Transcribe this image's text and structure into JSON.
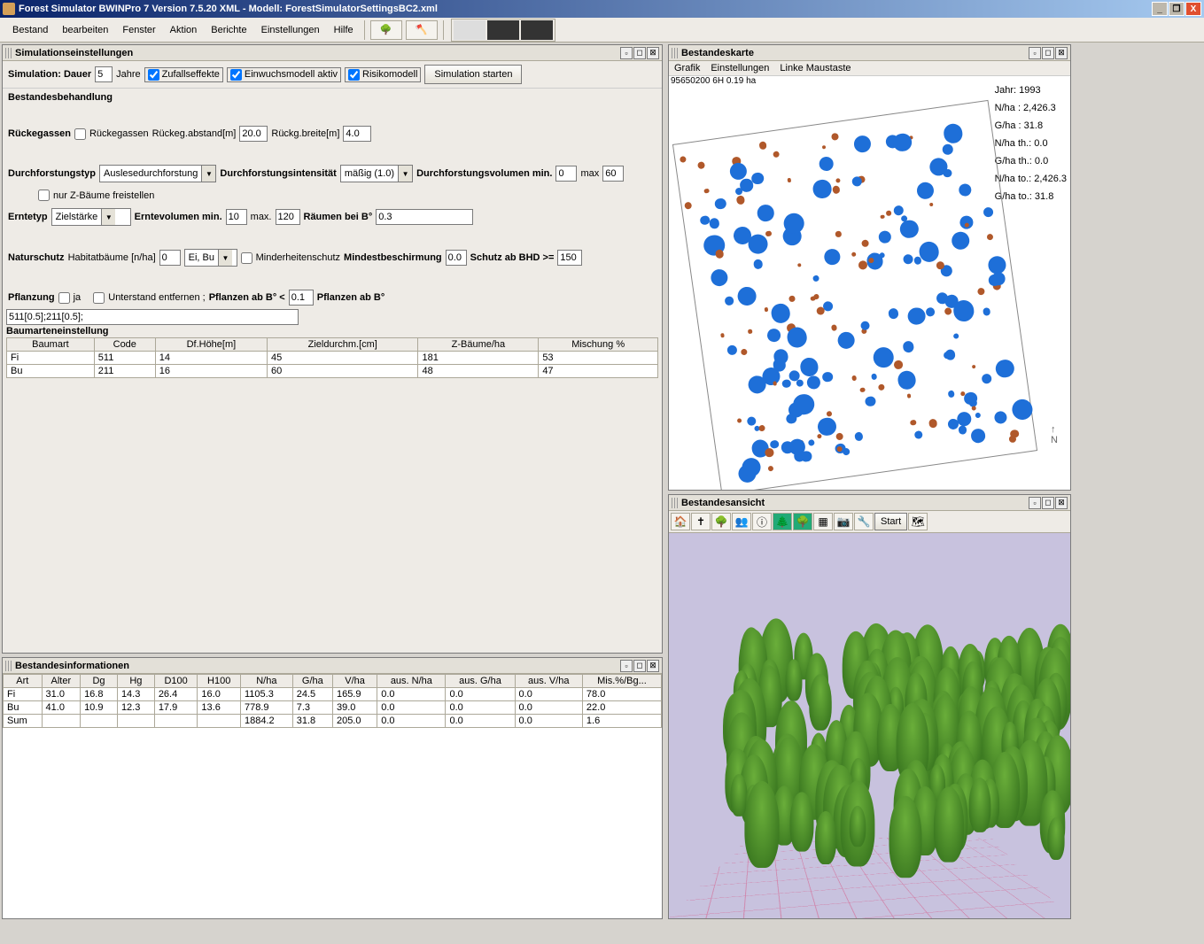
{
  "window": {
    "title": "Forest Simulator BWINPro 7 Version 7.5.20 XML - Modell: ForestSimulatorSettingsBC2.xml"
  },
  "menu": {
    "items": [
      "Bestand",
      "bearbeiten",
      "Fenster",
      "Aktion",
      "Berichte",
      "Einstellungen",
      "Hilfe"
    ]
  },
  "panels": {
    "sim": {
      "title": "Simulationseinstellungen"
    },
    "info": {
      "title": "Bestandesinformationen"
    },
    "map": {
      "title": "Bestandeskarte"
    },
    "view": {
      "title": "Bestandesansicht"
    }
  },
  "sim": {
    "simLabel": "Simulation: Dauer",
    "duration": "5",
    "years": "Jahre",
    "zufall": "Zufallseffekte",
    "einwuchs": "Einwuchsmodell aktiv",
    "risiko": "Risikomodell",
    "startBtn": "Simulation starten",
    "bestand": "Bestandesbehandlung",
    "ruecke": "Rückegassen",
    "rueckeChk": "Rückegassen",
    "rueckeAbst": "Rückeg.abstand[m]",
    "rueckeAbstV": "20.0",
    "rueckeBreite": "Rückg.breite[m]",
    "rueckeBreiteV": "4.0",
    "dfTyp": "Durchforstungstyp",
    "dfTypV": "Auslesedurchforstung",
    "dfInt": "Durchforstungsintensität",
    "dfIntV": "mäßig (1.0)",
    "dfVol": "Durchforstungsvolumen min.",
    "dfVolMin": "0",
    "max": "max",
    "dfVolMax": "60",
    "nurZ": "nur Z-Bäume freistellen",
    "ernte": "Erntetyp",
    "ernteV": "Zielstärke",
    "ernteVolMin": "Erntevolumen min.",
    "ernteVolMinV": "10",
    "ernteMax": "max.",
    "ernteVolMaxV": "120",
    "raeumen": "Räumen bei B°",
    "raeumenV": "0.3",
    "natur": "Naturschutz",
    "habitat": "Habitatbäume [n/ha]",
    "habitatV": "0",
    "species": "Ei, Bu",
    "minder": "Minderheitenschutz",
    "mindest": "Mindestbeschirmung",
    "mindestV": "0.0",
    "schutz": "Schutz ab BHD >=",
    "schutzV": "150",
    "pflanz": "Pflanzung",
    "ja": "ja",
    "unterstand": "Unterstand entfernen ;",
    "pflanzAb": "Pflanzen ab B°  <",
    "pflanzAbV": "0.1",
    "pflanzAb2": "Pflanzen ab B°",
    "pflanzStr": "511[0.5];211[0.5];",
    "baumEinst": "Baumarteneinstellung",
    "tblHead": [
      "Baumart",
      "Code",
      "Df.Höhe[m]",
      "Zieldurchm.[cm]",
      "Z-Bäume/ha",
      "Mischung %"
    ],
    "tblRows": [
      [
        "Fi",
        "511",
        "14",
        "45",
        "181",
        "53"
      ],
      [
        "Bu",
        "211",
        "16",
        "60",
        "48",
        "47"
      ]
    ]
  },
  "info": {
    "head": [
      "Art",
      "Alter",
      "Dg",
      "Hg",
      "D100",
      "H100",
      "N/ha",
      "G/ha",
      "V/ha",
      "aus. N/ha",
      "aus. G/ha",
      "aus. V/ha",
      "Mis.%/Bg..."
    ],
    "rows": [
      [
        "Fi",
        "31.0",
        "16.8",
        "14.3",
        "26.4",
        "16.0",
        "1105.3",
        "24.5",
        "165.9",
        "0.0",
        "0.0",
        "0.0",
        "78.0"
      ],
      [
        "Bu",
        "41.0",
        "10.9",
        "12.3",
        "17.9",
        "13.6",
        "778.9",
        "7.3",
        "39.0",
        "0.0",
        "0.0",
        "0.0",
        "22.0"
      ],
      [
        "Sum",
        "",
        "",
        "",
        "",
        "",
        "1884.2",
        "31.8",
        "205.0",
        "0.0",
        "0.0",
        "0.0",
        "1.6"
      ]
    ]
  },
  "map": {
    "menu": [
      "Grafik",
      "Einstellungen",
      "Linke Maustaste"
    ],
    "plotId": "95650200 6H  0.19 ha",
    "stats": [
      [
        "Jahr:",
        "1993"
      ],
      [
        "N/ha",
        ": 2,426.3"
      ],
      [
        "G/ha",
        ": 31.8"
      ],
      [
        "N/ha th.:",
        "0.0"
      ],
      [
        "G/ha th.:",
        "0.0"
      ],
      [
        "N/ha to.:",
        "2,426.3"
      ],
      [
        "G/ha to.:",
        "31.8"
      ]
    ],
    "compass": "N"
  },
  "view3d": {
    "start": "Start"
  }
}
